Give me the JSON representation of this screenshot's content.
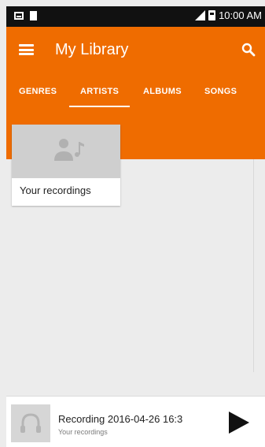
{
  "status_bar": {
    "time": "10:00 AM",
    "icons": [
      "screen-icon",
      "sd-card-icon",
      "signal-icon",
      "battery-icon"
    ]
  },
  "app_bar": {
    "title": "My Library",
    "menu_icon": "menu-icon",
    "search_icon": "search-icon",
    "color": "#ef6c00"
  },
  "tabs": [
    {
      "label": "GENRES"
    },
    {
      "label": "ARTISTS",
      "active": true
    },
    {
      "label": "ALBUMS"
    },
    {
      "label": "SONGS"
    }
  ],
  "library": {
    "cards": [
      {
        "label": "Your recordings",
        "icon": "artist-music-icon"
      }
    ]
  },
  "player": {
    "title": "Recording 2016-04-26 16:3",
    "subtitle": "Your recordings",
    "art_icon": "headphones-icon",
    "play_icon": "play-icon"
  }
}
